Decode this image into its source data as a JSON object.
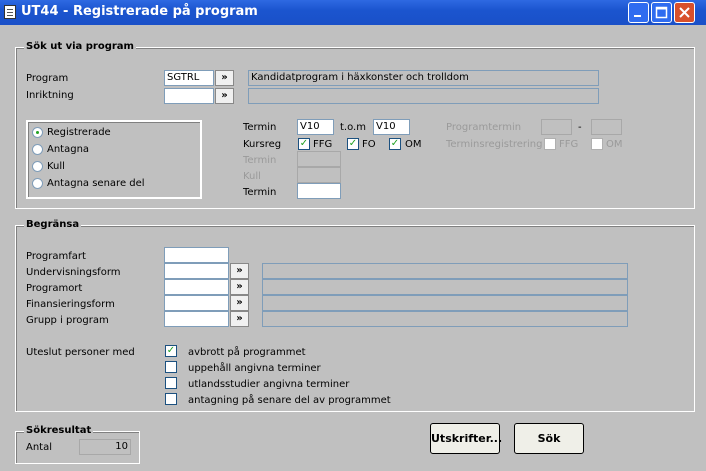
{
  "window": {
    "title": "UT44 - Registrerade på program",
    "icon": "document-icon"
  },
  "sok": {
    "title": "Sök ut via program",
    "program_label": "Program",
    "program_value": "SGTRL",
    "program_desc": "Kandidatprogram i häxkonster och trolldom",
    "inriktning_label": "Inriktning",
    "inriktning_value": "",
    "lookup_label": "»",
    "radios": [
      "Registrerade",
      "Antagna",
      "Kull",
      "Antagna senare del"
    ],
    "selected_radio": "Registrerade",
    "termin_label": "Termin",
    "termin_from": "V10",
    "tom_label": "t.o.m",
    "termin_to": "V10",
    "programtermin_label": "Programtermin",
    "dash": "-",
    "kursreg_label": "Kursreg",
    "kursreg_options": [
      "FFG",
      "FO",
      "OM"
    ],
    "terminsregistrering_label": "Terminsregistrering",
    "terminsreg_options": [
      "FFG",
      "OM"
    ],
    "termin2_label": "Termin",
    "kull_label": "Kull",
    "termin3_label": "Termin"
  },
  "begransa": {
    "title": "Begränsa",
    "programfart_label": "Programfart",
    "undervisningsform_label": "Undervisningsform",
    "programort_label": "Programort",
    "finansieringsform_label": "Finansieringsform",
    "grupp_label": "Grupp i program",
    "uteslut_label": "Uteslut personer med",
    "options": [
      {
        "label": "avbrott på programmet",
        "checked": true
      },
      {
        "label": "uppehåll angivna terminer",
        "checked": false
      },
      {
        "label": "utlandsstudier angivna terminer",
        "checked": false
      },
      {
        "label": "antagning på senare del av programmet",
        "checked": false
      }
    ]
  },
  "resultat": {
    "title": "Sökresultat",
    "antal_label": "Antal",
    "antal_value": "10"
  },
  "buttons": {
    "utskrifter": "Utskrifter...",
    "sok": "Sök"
  }
}
